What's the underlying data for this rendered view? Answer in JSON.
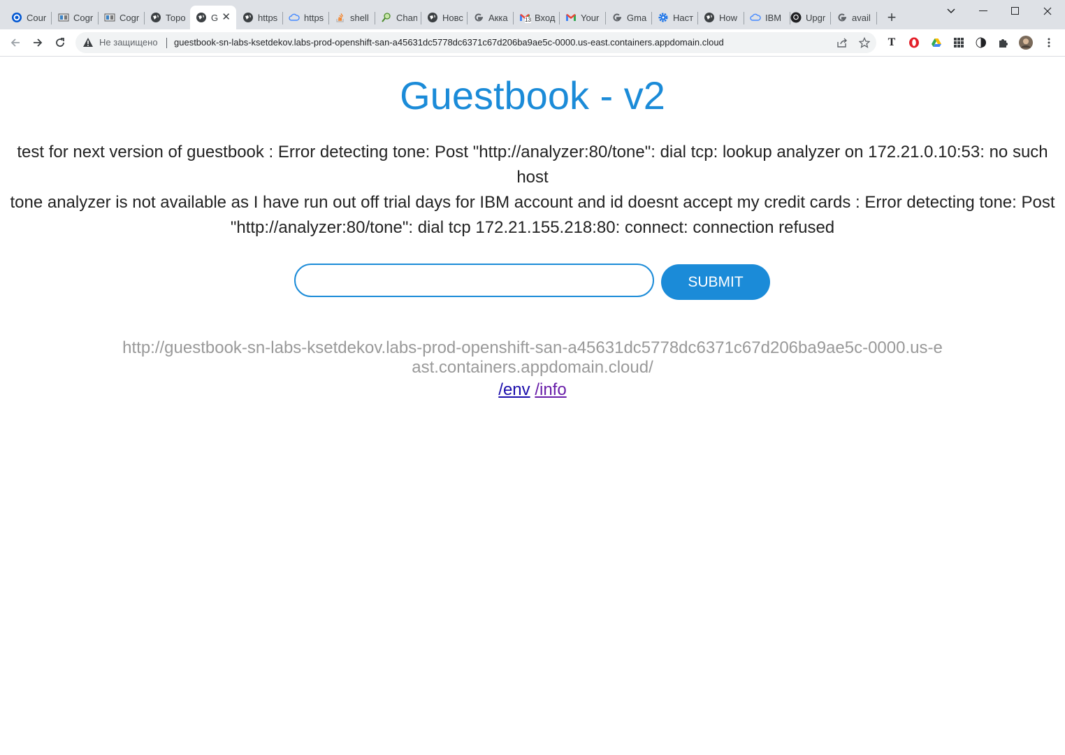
{
  "browser": {
    "tabs": [
      {
        "title": "Cour",
        "icon": "coursera-icon"
      },
      {
        "title": "Cogr",
        "icon": "cognitive-class-icon"
      },
      {
        "title": "Cogr",
        "icon": "cognitive-class-icon"
      },
      {
        "title": "Торо",
        "icon": "globe-icon"
      },
      {
        "title": "G",
        "icon": "globe-icon",
        "active": true
      },
      {
        "title": "https",
        "icon": "globe-icon"
      },
      {
        "title": "https",
        "icon": "cloud-icon"
      },
      {
        "title": "shell",
        "icon": "stackoverflow-icon"
      },
      {
        "title": "Chan",
        "icon": "search-doc-icon"
      },
      {
        "title": "Новс",
        "icon": "globe-icon"
      },
      {
        "title": "Акка",
        "icon": "google-icon"
      },
      {
        "title": "Вход",
        "icon": "gmail-icon",
        "badge": "13"
      },
      {
        "title": "Your",
        "icon": "gmail-icon"
      },
      {
        "title": "Gma",
        "icon": "google-icon"
      },
      {
        "title": "Наст",
        "icon": "settings-gear-icon"
      },
      {
        "title": "How",
        "icon": "globe-icon"
      },
      {
        "title": "IBM",
        "icon": "cloud-icon"
      },
      {
        "title": "Upgr",
        "icon": "github-icon"
      },
      {
        "title": "avail",
        "icon": "google-icon"
      }
    ],
    "new_tab_label": "+",
    "address_bar": {
      "security_label": "Не защищено",
      "url": "guestbook-sn-labs-ksetdekov.labs-prod-openshift-san-a45631dc5778dc6371c67d206ba9ae5c-0000.us-east.containers.appdomain.cloud"
    },
    "extensions": [
      "T"
    ]
  },
  "page": {
    "title": "Guestbook - v2",
    "entries": [
      "test for next version of guestbook : Error detecting tone: Post \"http://analyzer:80/tone\": dial tcp: lookup analyzer on 172.21.0.10:53: no such host",
      "tone analyzer is not available as I have run out off trial days for IBM account and id doesnt accept my credit cards : Error detecting tone: Post \"http://analyzer:80/tone\": dial tcp 172.21.155.218:80: connect: connection refused"
    ],
    "form": {
      "input_value": "",
      "submit_label": "SUBMIT"
    },
    "host_url": "http://guestbook-sn-labs-ksetdekov.labs-prod-openshift-san-a45631dc5778dc6371c67d206ba9ae5c-0000.us-east.containers.appdomain.cloud/",
    "links": {
      "env": "/env",
      "info": "/info"
    }
  },
  "colors": {
    "accent": "#1b8bd8",
    "muted_text": "#999999",
    "body_text": "#222222"
  }
}
